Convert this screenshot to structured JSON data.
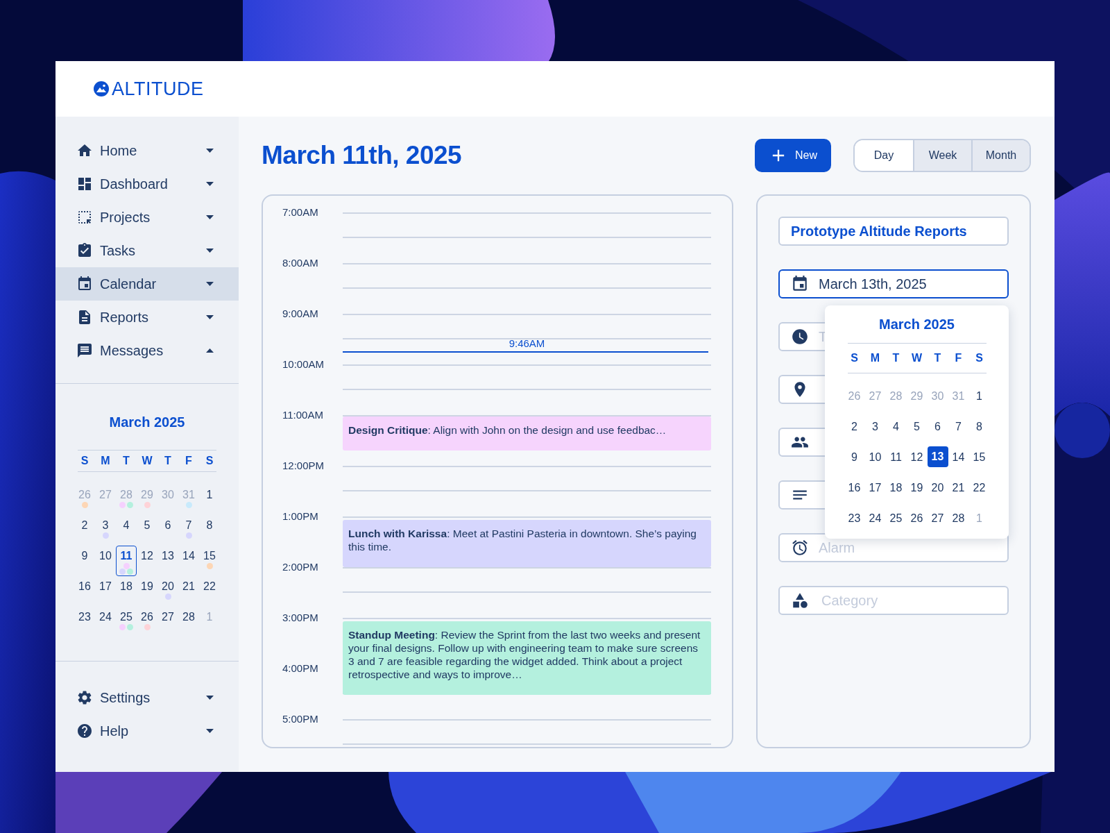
{
  "app": {
    "logo": "ALTITUDE"
  },
  "sidebar": {
    "nav": [
      {
        "label": "Home",
        "selected": false,
        "expanded": false
      },
      {
        "label": "Dashboard",
        "selected": false,
        "expanded": false
      },
      {
        "label": "Projects",
        "selected": false,
        "expanded": false
      },
      {
        "label": "Tasks",
        "selected": false,
        "expanded": false
      },
      {
        "label": "Calendar",
        "selected": true,
        "expanded": false
      },
      {
        "label": "Reports",
        "selected": false,
        "expanded": false
      },
      {
        "label": "Messages",
        "selected": false,
        "expanded": true
      }
    ],
    "mini_calendar": {
      "title": "March 2025",
      "weekdays": [
        "S",
        "M",
        "T",
        "W",
        "T",
        "F",
        "S"
      ],
      "days": [
        {
          "label": "26",
          "muted": true,
          "selected": false,
          "dots": [
            {
              "color": "#fdd6b5"
            }
          ]
        },
        {
          "label": "27",
          "muted": true,
          "selected": false
        },
        {
          "label": "28",
          "muted": true,
          "selected": false,
          "dots": [
            {
              "color": "#f5d0fe"
            },
            {
              "color": "#b4f0de"
            }
          ]
        },
        {
          "label": "29",
          "muted": true,
          "selected": false,
          "dots": [
            {
              "color": "#fed3d8"
            }
          ]
        },
        {
          "label": "30",
          "muted": true,
          "selected": false
        },
        {
          "label": "31",
          "muted": true,
          "selected": false,
          "dots": [
            {
              "color": "#c8eafc"
            }
          ]
        },
        {
          "label": "1",
          "muted": false,
          "selected": false
        },
        {
          "label": "2",
          "muted": false,
          "selected": false
        },
        {
          "label": "3",
          "muted": false,
          "selected": false,
          "dots": [
            {
              "color": "#d6d6fd"
            }
          ]
        },
        {
          "label": "4",
          "muted": false,
          "selected": false
        },
        {
          "label": "5",
          "muted": false,
          "selected": false
        },
        {
          "label": "6",
          "muted": false,
          "selected": false
        },
        {
          "label": "7",
          "muted": false,
          "selected": false,
          "dots": [
            {
              "color": "#d6d6fd"
            }
          ]
        },
        {
          "label": "8",
          "muted": false,
          "selected": false
        },
        {
          "label": "9",
          "muted": false,
          "selected": false
        },
        {
          "label": "10",
          "muted": false,
          "selected": false
        },
        {
          "label": "11",
          "muted": false,
          "selected": true,
          "dots": [
            {
              "color": "#d6d6fd"
            },
            {
              "color": "#b4f0de"
            },
            {
              "color": "#f5d0fe"
            }
          ]
        },
        {
          "label": "12",
          "muted": false,
          "selected": false
        },
        {
          "label": "13",
          "muted": false,
          "selected": false
        },
        {
          "label": "14",
          "muted": false,
          "selected": false
        },
        {
          "label": "15",
          "muted": false,
          "selected": false,
          "dots": [
            {
              "color": "#fdd6b5"
            }
          ]
        },
        {
          "label": "16",
          "muted": false,
          "selected": false
        },
        {
          "label": "17",
          "muted": false,
          "selected": false
        },
        {
          "label": "18",
          "muted": false,
          "selected": false
        },
        {
          "label": "19",
          "muted": false,
          "selected": false
        },
        {
          "label": "20",
          "muted": false,
          "selected": false,
          "dots": [
            {
              "color": "#d6d6fd"
            }
          ]
        },
        {
          "label": "21",
          "muted": false,
          "selected": false
        },
        {
          "label": "22",
          "muted": false,
          "selected": false
        },
        {
          "label": "23",
          "muted": false,
          "selected": false
        },
        {
          "label": "24",
          "muted": false,
          "selected": false
        },
        {
          "label": "25",
          "muted": false,
          "selected": false,
          "dots": [
            {
              "color": "#f5d0fe"
            },
            {
              "color": "#b4f0de"
            }
          ]
        },
        {
          "label": "26",
          "muted": false,
          "selected": false,
          "dots": [
            {
              "color": "#fed3d8"
            }
          ]
        },
        {
          "label": "27",
          "muted": false,
          "selected": false
        },
        {
          "label": "28",
          "muted": false,
          "selected": false
        },
        {
          "label": "1",
          "muted": true,
          "selected": false
        }
      ]
    },
    "footer_nav": [
      {
        "label": "Settings",
        "expanded": false
      },
      {
        "label": "Help",
        "expanded": false
      }
    ]
  },
  "header": {
    "title": "March 11th, 2025",
    "new_button": "New",
    "views": [
      {
        "label": "Day",
        "selected": true
      },
      {
        "label": "Week",
        "selected": false
      },
      {
        "label": "Month",
        "selected": false
      }
    ]
  },
  "timeline": {
    "hours": [
      {
        "label": "7:00AM"
      },
      {
        "label": "8:00AM"
      },
      {
        "label": "9:00AM",
        "now_marker": "9:46AM"
      },
      {
        "label": "10:00AM"
      },
      {
        "label": "11:00AM",
        "event": {
          "text": "**Design Critique**: Align with John on the design and use feedbac…",
          "color": "#f6d4fd"
        }
      },
      {
        "label": "12:00PM"
      },
      {
        "label": "1:00PM",
        "event": {
          "text": "**Lunch with Karissa**: Meet at Pastini Pasteria in downtown. She’s paying this time.",
          "color": "#d6d6fd"
        }
      },
      {
        "label": "2:00PM"
      },
      {
        "label": "3:00PM",
        "event": {
          "text": "**Standup Meeting**: Review the Sprint from the last two weeks and present your final designs. Follow up with engineering team to make sure screens 3 and 7 are feasible regarding the widget added. Think about a project retrospective and ways to improve…",
          "color": "#b4f0de"
        }
      },
      {
        "label": "4:00PM"
      },
      {
        "label": "5:00PM"
      }
    ]
  },
  "event_form": {
    "fields": [
      {
        "kind": "title",
        "value": "Prototype Altitude Reports",
        "focused": false
      },
      {
        "kind": "date",
        "value": "March 13th, 2025",
        "focused": true
      },
      {
        "kind": "input",
        "placeholder": "T",
        "focused": false
      },
      {
        "kind": "input",
        "focused": false
      },
      {
        "kind": "input",
        "focused": false
      },
      {
        "kind": "input",
        "focused": false
      },
      {
        "kind": "input",
        "placeholder": "Alarm",
        "focused": false
      },
      {
        "kind": "input",
        "placeholder": "Category",
        "focused": false
      }
    ],
    "date_picker": {
      "title": "March 2025",
      "weekdays": [
        "S",
        "M",
        "T",
        "W",
        "T",
        "F",
        "S"
      ],
      "days": [
        {
          "label": "26",
          "muted": true,
          "selected": false
        },
        {
          "label": "27",
          "muted": true,
          "selected": false
        },
        {
          "label": "28",
          "muted": true,
          "selected": false
        },
        {
          "label": "29",
          "muted": true,
          "selected": false
        },
        {
          "label": "30",
          "muted": true,
          "selected": false
        },
        {
          "label": "31",
          "muted": true,
          "selected": false
        },
        {
          "label": "1",
          "muted": false,
          "selected": false
        },
        {
          "label": "2",
          "muted": false,
          "selected": false
        },
        {
          "label": "3",
          "muted": false,
          "selected": false
        },
        {
          "label": "4",
          "muted": false,
          "selected": false
        },
        {
          "label": "5",
          "muted": false,
          "selected": false
        },
        {
          "label": "6",
          "muted": false,
          "selected": false
        },
        {
          "label": "7",
          "muted": false,
          "selected": false
        },
        {
          "label": "8",
          "muted": false,
          "selected": false
        },
        {
          "label": "9",
          "muted": false,
          "selected": false
        },
        {
          "label": "10",
          "muted": false,
          "selected": false
        },
        {
          "label": "11",
          "muted": false,
          "selected": false
        },
        {
          "label": "12",
          "muted": false,
          "selected": false
        },
        {
          "label": "13",
          "muted": false,
          "selected": true
        },
        {
          "label": "14",
          "muted": false,
          "selected": false
        },
        {
          "label": "15",
          "muted": false,
          "selected": false
        },
        {
          "label": "16",
          "muted": false,
          "selected": false
        },
        {
          "label": "17",
          "muted": false,
          "selected": false
        },
        {
          "label": "18",
          "muted": false,
          "selected": false
        },
        {
          "label": "19",
          "muted": false,
          "selected": false
        },
        {
          "label": "20",
          "muted": false,
          "selected": false
        },
        {
          "label": "21",
          "muted": false,
          "selected": false
        },
        {
          "label": "22",
          "muted": false,
          "selected": false
        },
        {
          "label": "23",
          "muted": false,
          "selected": false
        },
        {
          "label": "24",
          "muted": false,
          "selected": false
        },
        {
          "label": "25",
          "muted": false,
          "selected": false
        },
        {
          "label": "26",
          "muted": false,
          "selected": false
        },
        {
          "label": "27",
          "muted": false,
          "selected": false
        },
        {
          "label": "28",
          "muted": false,
          "selected": false
        },
        {
          "label": "1",
          "muted": true,
          "selected": false
        }
      ]
    }
  }
}
